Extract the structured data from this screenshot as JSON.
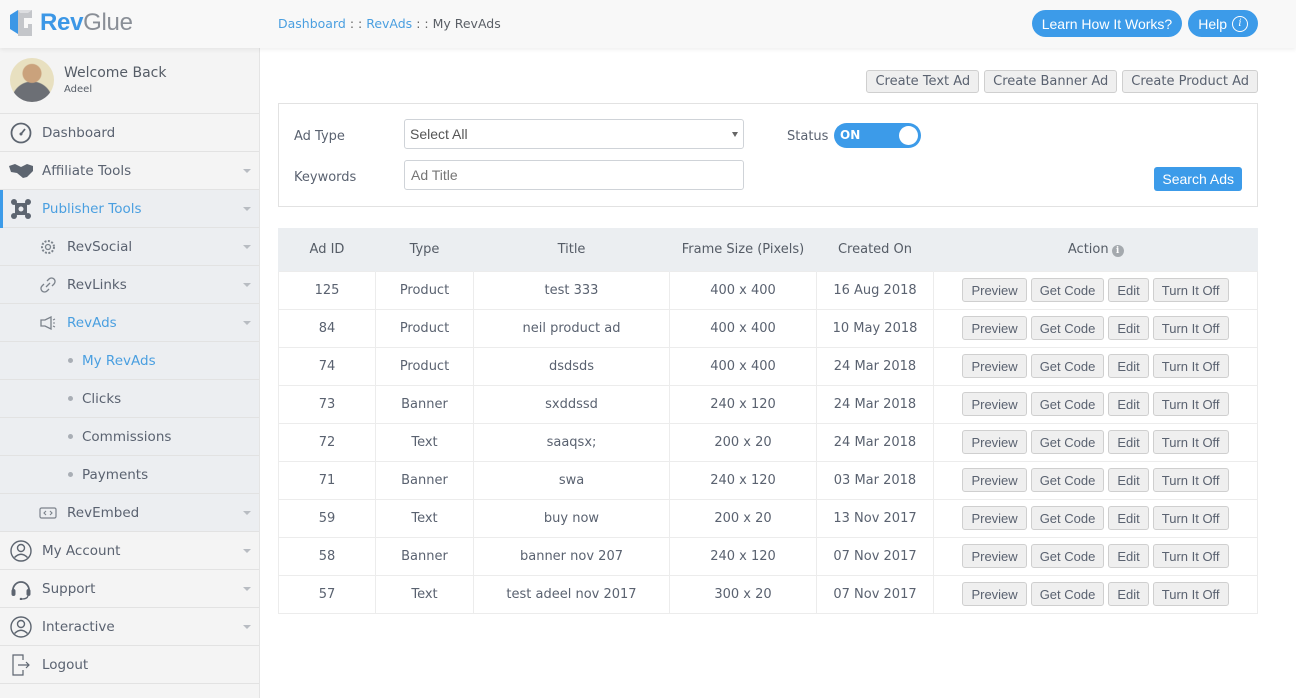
{
  "header": {
    "logo": {
      "part1": "Rev",
      "part2": "Glue"
    },
    "breadcrumb": [
      {
        "label": "Dashboard",
        "link": true
      },
      {
        "label": "RevAds",
        "link": true
      },
      {
        "label": "My RevAds",
        "link": false
      }
    ],
    "breadcrumb_sep": ": :",
    "learn_button": "Learn How It Works?",
    "help_button": "Help",
    "help_icon_glyph": "i"
  },
  "sidebar": {
    "welcome": "Welcome Back",
    "username": "Adeel",
    "items": [
      {
        "label": "Dashboard",
        "icon": "dashboard-gauge-icon",
        "level": "top",
        "caret": false
      },
      {
        "label": "Affiliate Tools",
        "icon": "handshake-icon",
        "level": "top",
        "caret": true
      },
      {
        "label": "Publisher Tools",
        "icon": "publisher-tools-icon",
        "level": "top",
        "caret": true,
        "active": true
      },
      {
        "label": "RevSocial",
        "icon": "gear-icon",
        "level": "sub",
        "caret": true
      },
      {
        "label": "RevLinks",
        "icon": "link-icon",
        "level": "sub",
        "caret": true
      },
      {
        "label": "RevAds",
        "icon": "megaphone-icon",
        "level": "sub",
        "caret": true,
        "active": true
      },
      {
        "label": "My RevAds",
        "level": "leaf",
        "active": true
      },
      {
        "label": "Clicks",
        "level": "leaf"
      },
      {
        "label": "Commissions",
        "level": "leaf"
      },
      {
        "label": "Payments",
        "level": "leaf"
      },
      {
        "label": "RevEmbed",
        "icon": "embed-code-icon",
        "level": "sub",
        "caret": true
      },
      {
        "label": "My Account",
        "icon": "user-circle-icon",
        "level": "top",
        "caret": true
      },
      {
        "label": "Support",
        "icon": "headset-icon",
        "level": "top",
        "caret": true
      },
      {
        "label": "Interactive",
        "icon": "user-circle-icon",
        "level": "top",
        "caret": true
      },
      {
        "label": "Logout",
        "icon": "logout-icon",
        "level": "top",
        "caret": false
      }
    ]
  },
  "toolbar": {
    "create_text": "Create Text Ad",
    "create_banner": "Create Banner Ad",
    "create_product": "Create Product Ad"
  },
  "filter": {
    "ad_type_label": "Ad Type",
    "ad_type_value": "Select All",
    "keywords_label": "Keywords",
    "keywords_placeholder": "Ad Title",
    "keywords_value": "",
    "status_label": "Status",
    "status_value": "ON",
    "search_button": "Search Ads"
  },
  "table": {
    "columns": [
      "Ad ID",
      "Type",
      "Title",
      "Frame Size (Pixels)",
      "Created On",
      "Action"
    ],
    "action_info_glyph": "i",
    "action_buttons": [
      "Preview",
      "Get Code",
      "Edit",
      "Turn It Off"
    ],
    "rows": [
      {
        "id": "125",
        "type": "Product",
        "title": "test 333",
        "size": "400 x 400",
        "created": "16 Aug 2018"
      },
      {
        "id": "84",
        "type": "Product",
        "title": "neil product ad",
        "size": "400 x 400",
        "created": "10 May 2018"
      },
      {
        "id": "74",
        "type": "Product",
        "title": "dsdsds",
        "size": "400 x 400",
        "created": "24 Mar 2018"
      },
      {
        "id": "73",
        "type": "Banner",
        "title": "sxddssd",
        "size": "240 x 120",
        "created": "24 Mar 2018"
      },
      {
        "id": "72",
        "type": "Text",
        "title": "saaqsx;",
        "size": "200 x 20",
        "created": "24 Mar 2018"
      },
      {
        "id": "71",
        "type": "Banner",
        "title": "swa",
        "size": "240 x 120",
        "created": "03 Mar 2018"
      },
      {
        "id": "59",
        "type": "Text",
        "title": "buy now",
        "size": "200 x 20",
        "created": "13 Nov 2017"
      },
      {
        "id": "58",
        "type": "Banner",
        "title": "banner nov 207",
        "size": "240 x 120",
        "created": "07 Nov 2017"
      },
      {
        "id": "57",
        "type": "Text",
        "title": "test adeel nov 2017",
        "size": "300 x 20",
        "created": "07 Nov 2017"
      }
    ]
  },
  "colors": {
    "accent": "#3c9be9",
    "link": "#4a9fe0",
    "text": "#5a6270"
  }
}
